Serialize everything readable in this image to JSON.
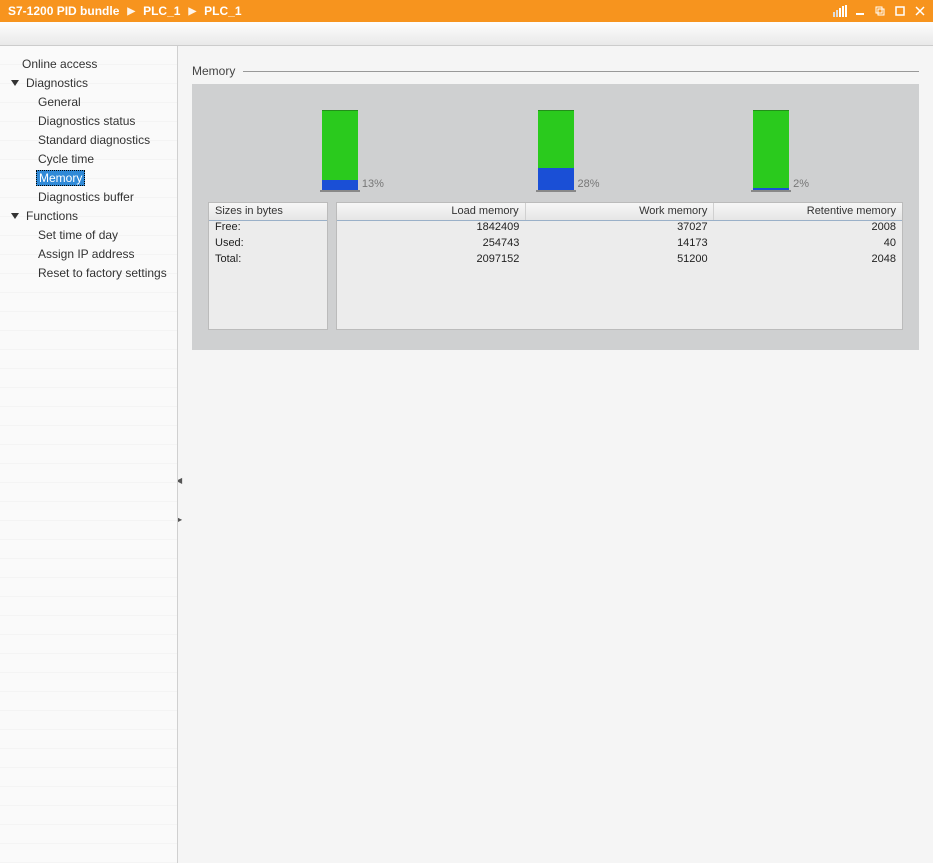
{
  "breadcrumb": [
    "S7-1200 PID bundle",
    "PLC_1",
    "PLC_1"
  ],
  "sidebar": {
    "items": [
      {
        "label": "Online access",
        "level": 0,
        "expandable": false
      },
      {
        "label": "Diagnostics",
        "level": 1,
        "expandable": true,
        "expanded": true
      },
      {
        "label": "General",
        "level": 2
      },
      {
        "label": "Diagnostics status",
        "level": 2
      },
      {
        "label": "Standard diagnostics",
        "level": 2
      },
      {
        "label": "Cycle time",
        "level": 2
      },
      {
        "label": "Memory",
        "level": 2,
        "selected": true
      },
      {
        "label": "Diagnostics buffer",
        "level": 2
      },
      {
        "label": "Functions",
        "level": 1,
        "expandable": true,
        "expanded": true
      },
      {
        "label": "Set time of day",
        "level": 2
      },
      {
        "label": "Assign IP address",
        "level": 2
      },
      {
        "label": "Reset to factory settings",
        "level": 2
      }
    ]
  },
  "panel": {
    "title": "Memory"
  },
  "chart_data": {
    "type": "bar",
    "series": [
      {
        "name": "Load memory",
        "used_pct": 13,
        "pct_label": "13%"
      },
      {
        "name": "Work memory",
        "used_pct": 28,
        "pct_label": "28%"
      },
      {
        "name": "Retentive memory",
        "used_pct": 2,
        "pct_label": "2%"
      }
    ],
    "ylim": [
      0,
      100
    ],
    "colors": {
      "used": "#1a4fd6",
      "free": "#2aca1d"
    }
  },
  "table": {
    "header_left": "Sizes in bytes",
    "columns": [
      "Load memory",
      "Work memory",
      "Retentive memory"
    ],
    "rows": [
      {
        "label": "Free:",
        "values": [
          "1842409",
          "37027",
          "2008"
        ]
      },
      {
        "label": "Used:",
        "values": [
          "254743",
          "14173",
          "40"
        ]
      },
      {
        "label": "Total:",
        "values": [
          "2097152",
          "51200",
          "2048"
        ]
      }
    ]
  }
}
